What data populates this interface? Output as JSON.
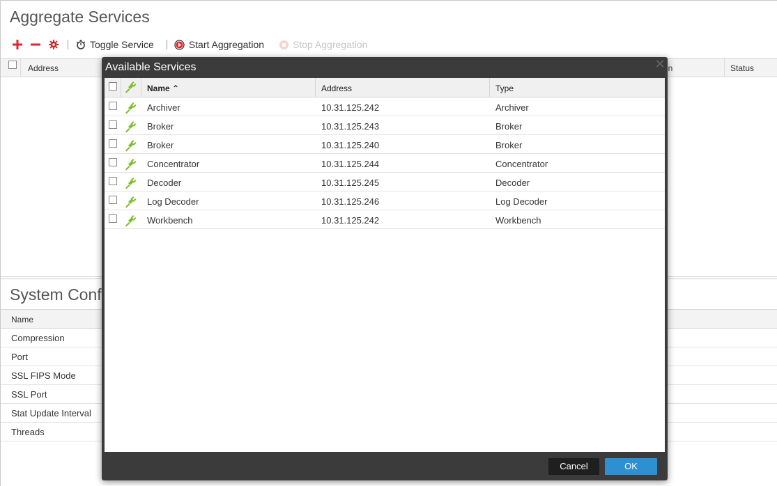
{
  "background": {
    "title": "Aggregate Services",
    "toolbar": {
      "toggle_service": "Toggle Service",
      "start_aggregation": "Start Aggregation",
      "stop_aggregation": "Stop Aggregation"
    },
    "grid_columns": {
      "address": "Address",
      "action_partial": "on",
      "status": "Status"
    },
    "system_config": {
      "title": "System Confi",
      "column_name": "Name",
      "rows": [
        "Compression",
        "Port",
        "SSL FIPS Mode",
        "SSL Port",
        "Stat Update Interval",
        "Threads"
      ]
    }
  },
  "colors": {
    "add": "#e8202a",
    "remove": "#e8202a",
    "settings": "#d12b2b",
    "ok_button": "#2e8fd1",
    "plug": "#7bbf2a"
  },
  "modal": {
    "title": "Available Services",
    "close_glyph": "✕",
    "columns": {
      "name": "Name ⌃",
      "address": "Address",
      "type": "Type"
    },
    "rows": [
      {
        "name": "Archiver",
        "address": "10.31.125.242",
        "type": "Archiver"
      },
      {
        "name": "Broker",
        "address": "10.31.125.243",
        "type": "Broker"
      },
      {
        "name": "Broker",
        "address": "10.31.125.240",
        "type": "Broker"
      },
      {
        "name": "Concentrator",
        "address": "10.31.125.244",
        "type": "Concentrator"
      },
      {
        "name": "Decoder",
        "address": "10.31.125.245",
        "type": "Decoder"
      },
      {
        "name": "Log Decoder",
        "address": "10.31.125.246",
        "type": "Log Decoder"
      },
      {
        "name": "Workbench",
        "address": "10.31.125.242",
        "type": "Workbench"
      }
    ],
    "cancel_label": "Cancel",
    "ok_label": "OK"
  }
}
